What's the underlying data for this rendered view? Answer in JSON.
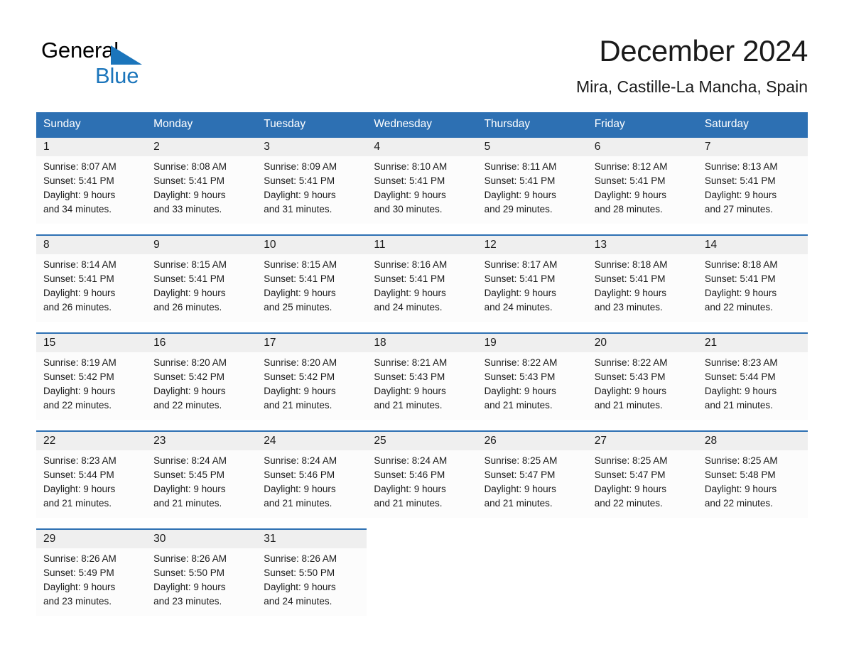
{
  "logo": {
    "word_one": "General",
    "word_two": "Blue",
    "triangle_color": "#1b75bb"
  },
  "header": {
    "month_title": "December 2024",
    "location": "Mira, Castille-La Mancha, Spain"
  },
  "theme": {
    "header_blue": "#2d70b3",
    "date_row_gray": "#efefef",
    "cell_bg": "#fcfcfc",
    "text": "#1a1a1a"
  },
  "calendar": {
    "weekday_headers": [
      "Sunday",
      "Monday",
      "Tuesday",
      "Wednesday",
      "Thursday",
      "Friday",
      "Saturday"
    ],
    "weeks": [
      [
        {
          "day": "1",
          "sunrise": "Sunrise: 8:07 AM",
          "sunset": "Sunset: 5:41 PM",
          "daylight_line1": "Daylight: 9 hours",
          "daylight_line2": "and 34 minutes."
        },
        {
          "day": "2",
          "sunrise": "Sunrise: 8:08 AM",
          "sunset": "Sunset: 5:41 PM",
          "daylight_line1": "Daylight: 9 hours",
          "daylight_line2": "and 33 minutes."
        },
        {
          "day": "3",
          "sunrise": "Sunrise: 8:09 AM",
          "sunset": "Sunset: 5:41 PM",
          "daylight_line1": "Daylight: 9 hours",
          "daylight_line2": "and 31 minutes."
        },
        {
          "day": "4",
          "sunrise": "Sunrise: 8:10 AM",
          "sunset": "Sunset: 5:41 PM",
          "daylight_line1": "Daylight: 9 hours",
          "daylight_line2": "and 30 minutes."
        },
        {
          "day": "5",
          "sunrise": "Sunrise: 8:11 AM",
          "sunset": "Sunset: 5:41 PM",
          "daylight_line1": "Daylight: 9 hours",
          "daylight_line2": "and 29 minutes."
        },
        {
          "day": "6",
          "sunrise": "Sunrise: 8:12 AM",
          "sunset": "Sunset: 5:41 PM",
          "daylight_line1": "Daylight: 9 hours",
          "daylight_line2": "and 28 minutes."
        },
        {
          "day": "7",
          "sunrise": "Sunrise: 8:13 AM",
          "sunset": "Sunset: 5:41 PM",
          "daylight_line1": "Daylight: 9 hours",
          "daylight_line2": "and 27 minutes."
        }
      ],
      [
        {
          "day": "8",
          "sunrise": "Sunrise: 8:14 AM",
          "sunset": "Sunset: 5:41 PM",
          "daylight_line1": "Daylight: 9 hours",
          "daylight_line2": "and 26 minutes."
        },
        {
          "day": "9",
          "sunrise": "Sunrise: 8:15 AM",
          "sunset": "Sunset: 5:41 PM",
          "daylight_line1": "Daylight: 9 hours",
          "daylight_line2": "and 26 minutes."
        },
        {
          "day": "10",
          "sunrise": "Sunrise: 8:15 AM",
          "sunset": "Sunset: 5:41 PM",
          "daylight_line1": "Daylight: 9 hours",
          "daylight_line2": "and 25 minutes."
        },
        {
          "day": "11",
          "sunrise": "Sunrise: 8:16 AM",
          "sunset": "Sunset: 5:41 PM",
          "daylight_line1": "Daylight: 9 hours",
          "daylight_line2": "and 24 minutes."
        },
        {
          "day": "12",
          "sunrise": "Sunrise: 8:17 AM",
          "sunset": "Sunset: 5:41 PM",
          "daylight_line1": "Daylight: 9 hours",
          "daylight_line2": "and 24 minutes."
        },
        {
          "day": "13",
          "sunrise": "Sunrise: 8:18 AM",
          "sunset": "Sunset: 5:41 PM",
          "daylight_line1": "Daylight: 9 hours",
          "daylight_line2": "and 23 minutes."
        },
        {
          "day": "14",
          "sunrise": "Sunrise: 8:18 AM",
          "sunset": "Sunset: 5:41 PM",
          "daylight_line1": "Daylight: 9 hours",
          "daylight_line2": "and 22 minutes."
        }
      ],
      [
        {
          "day": "15",
          "sunrise": "Sunrise: 8:19 AM",
          "sunset": "Sunset: 5:42 PM",
          "daylight_line1": "Daylight: 9 hours",
          "daylight_line2": "and 22 minutes."
        },
        {
          "day": "16",
          "sunrise": "Sunrise: 8:20 AM",
          "sunset": "Sunset: 5:42 PM",
          "daylight_line1": "Daylight: 9 hours",
          "daylight_line2": "and 22 minutes."
        },
        {
          "day": "17",
          "sunrise": "Sunrise: 8:20 AM",
          "sunset": "Sunset: 5:42 PM",
          "daylight_line1": "Daylight: 9 hours",
          "daylight_line2": "and 21 minutes."
        },
        {
          "day": "18",
          "sunrise": "Sunrise: 8:21 AM",
          "sunset": "Sunset: 5:43 PM",
          "daylight_line1": "Daylight: 9 hours",
          "daylight_line2": "and 21 minutes."
        },
        {
          "day": "19",
          "sunrise": "Sunrise: 8:22 AM",
          "sunset": "Sunset: 5:43 PM",
          "daylight_line1": "Daylight: 9 hours",
          "daylight_line2": "and 21 minutes."
        },
        {
          "day": "20",
          "sunrise": "Sunrise: 8:22 AM",
          "sunset": "Sunset: 5:43 PM",
          "daylight_line1": "Daylight: 9 hours",
          "daylight_line2": "and 21 minutes."
        },
        {
          "day": "21",
          "sunrise": "Sunrise: 8:23 AM",
          "sunset": "Sunset: 5:44 PM",
          "daylight_line1": "Daylight: 9 hours",
          "daylight_line2": "and 21 minutes."
        }
      ],
      [
        {
          "day": "22",
          "sunrise": "Sunrise: 8:23 AM",
          "sunset": "Sunset: 5:44 PM",
          "daylight_line1": "Daylight: 9 hours",
          "daylight_line2": "and 21 minutes."
        },
        {
          "day": "23",
          "sunrise": "Sunrise: 8:24 AM",
          "sunset": "Sunset: 5:45 PM",
          "daylight_line1": "Daylight: 9 hours",
          "daylight_line2": "and 21 minutes."
        },
        {
          "day": "24",
          "sunrise": "Sunrise: 8:24 AM",
          "sunset": "Sunset: 5:46 PM",
          "daylight_line1": "Daylight: 9 hours",
          "daylight_line2": "and 21 minutes."
        },
        {
          "day": "25",
          "sunrise": "Sunrise: 8:24 AM",
          "sunset": "Sunset: 5:46 PM",
          "daylight_line1": "Daylight: 9 hours",
          "daylight_line2": "and 21 minutes."
        },
        {
          "day": "26",
          "sunrise": "Sunrise: 8:25 AM",
          "sunset": "Sunset: 5:47 PM",
          "daylight_line1": "Daylight: 9 hours",
          "daylight_line2": "and 21 minutes."
        },
        {
          "day": "27",
          "sunrise": "Sunrise: 8:25 AM",
          "sunset": "Sunset: 5:47 PM",
          "daylight_line1": "Daylight: 9 hours",
          "daylight_line2": "and 22 minutes."
        },
        {
          "day": "28",
          "sunrise": "Sunrise: 8:25 AM",
          "sunset": "Sunset: 5:48 PM",
          "daylight_line1": "Daylight: 9 hours",
          "daylight_line2": "and 22 minutes."
        }
      ],
      [
        {
          "day": "29",
          "sunrise": "Sunrise: 8:26 AM",
          "sunset": "Sunset: 5:49 PM",
          "daylight_line1": "Daylight: 9 hours",
          "daylight_line2": "and 23 minutes."
        },
        {
          "day": "30",
          "sunrise": "Sunrise: 8:26 AM",
          "sunset": "Sunset: 5:50 PM",
          "daylight_line1": "Daylight: 9 hours",
          "daylight_line2": "and 23 minutes."
        },
        {
          "day": "31",
          "sunrise": "Sunrise: 8:26 AM",
          "sunset": "Sunset: 5:50 PM",
          "daylight_line1": "Daylight: 9 hours",
          "daylight_line2": "and 24 minutes."
        },
        {
          "day": "",
          "sunrise": "",
          "sunset": "",
          "daylight_line1": "",
          "daylight_line2": ""
        },
        {
          "day": "",
          "sunrise": "",
          "sunset": "",
          "daylight_line1": "",
          "daylight_line2": ""
        },
        {
          "day": "",
          "sunrise": "",
          "sunset": "",
          "daylight_line1": "",
          "daylight_line2": ""
        },
        {
          "day": "",
          "sunrise": "",
          "sunset": "",
          "daylight_line1": "",
          "daylight_line2": ""
        }
      ]
    ]
  }
}
